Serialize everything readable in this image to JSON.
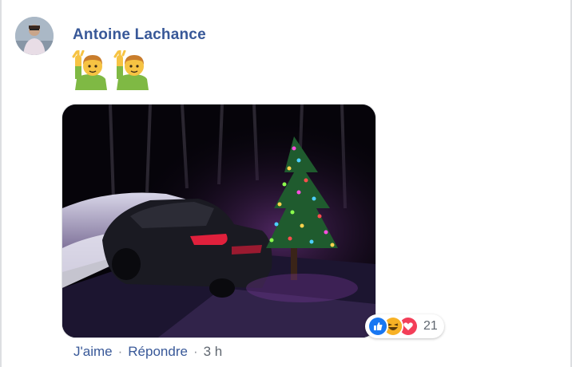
{
  "comment": {
    "author": "Antoine Lachance",
    "emojis": [
      "raising-hand-man-emoji",
      "raising-hand-man-emoji"
    ],
    "photo_icon": "christmas-tree-car-photo",
    "reactions": {
      "types": [
        "like",
        "haha",
        "love"
      ],
      "count": "21",
      "colors": {
        "like": "#1877f2",
        "haha": "#f7b125",
        "love": "#f33e58"
      }
    },
    "actions": {
      "like_label": "J'aime",
      "reply_label": "Répondre",
      "separator": "·",
      "time": "3 h"
    }
  },
  "theme": {
    "author_color": "#385898",
    "link_color": "#385898",
    "muted_color": "#606770"
  }
}
